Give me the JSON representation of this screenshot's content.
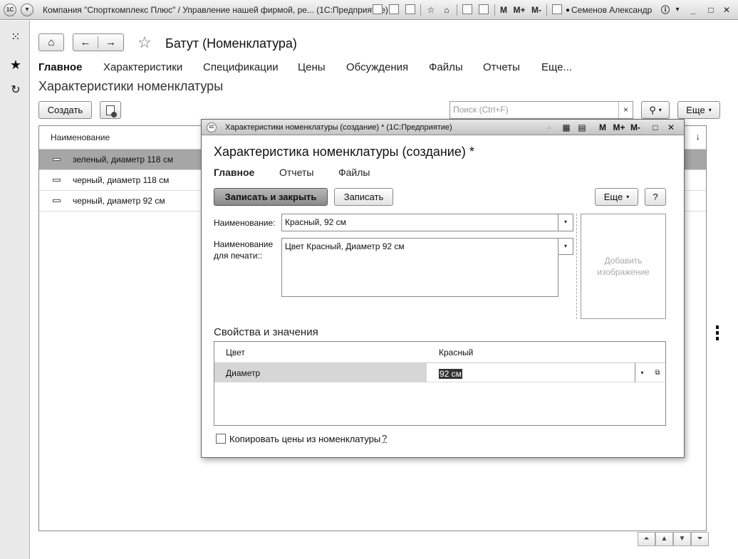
{
  "window": {
    "logo_text": "1C",
    "title": "Компания \"Спорткомплекс Плюс\" / Управление нашей фирмой, ре... (1С:Предприятие)",
    "toolbar": {
      "m": "M",
      "m_plus": "M+",
      "m_minus": "M-"
    },
    "user": "Семенов Александр"
  },
  "page": {
    "title": "Батут (Номенклатура)",
    "tabs": [
      "Главное",
      "Характеристики",
      "Спецификации",
      "Цены",
      "Обсуждения",
      "Файлы",
      "Отчеты",
      "Еще..."
    ],
    "section_title": "Характеристики номенклатуры",
    "create_label": "Создать",
    "search_placeholder": "Поиск (Ctrl+F)",
    "search_clear": "×",
    "more_label": "Еще",
    "list": {
      "column_name": "Наименование",
      "sort_mark": "↓",
      "rows": [
        "зеленый, диаметр 118 см",
        "черный, диаметр 118 см",
        "черный, диаметр 92 см"
      ]
    }
  },
  "dialog": {
    "window_title": "Характеристики номенклатуры (создание) * (1С:Предприятие)",
    "toolbar": {
      "m": "M",
      "m_plus": "M+",
      "m_minus": "M-"
    },
    "heading": "Характеристика номенклатуры (создание) *",
    "tabs": [
      "Главное",
      "Отчеты",
      "Файлы"
    ],
    "save_close_label": "Записать и закрыть",
    "save_label": "Записать",
    "more_label": "Еще",
    "help_label": "?",
    "name_label": "Наименование:",
    "name_value": "Красный, 92 см",
    "print_name_label_1": "Наименование",
    "print_name_label_2": "для печати::",
    "print_name_value": "Цвет Красный, Диаметр 92 см",
    "image_placeholder_1": "Добавить",
    "image_placeholder_2": "изображение",
    "properties_title": "Свойства и значения",
    "properties": [
      {
        "name": "Цвет",
        "value": "Красный"
      },
      {
        "name": "Диаметр",
        "value": "92 см"
      }
    ],
    "copy_prices_label": "Копировать цены из номенклатуры",
    "copy_prices_help": "?"
  }
}
